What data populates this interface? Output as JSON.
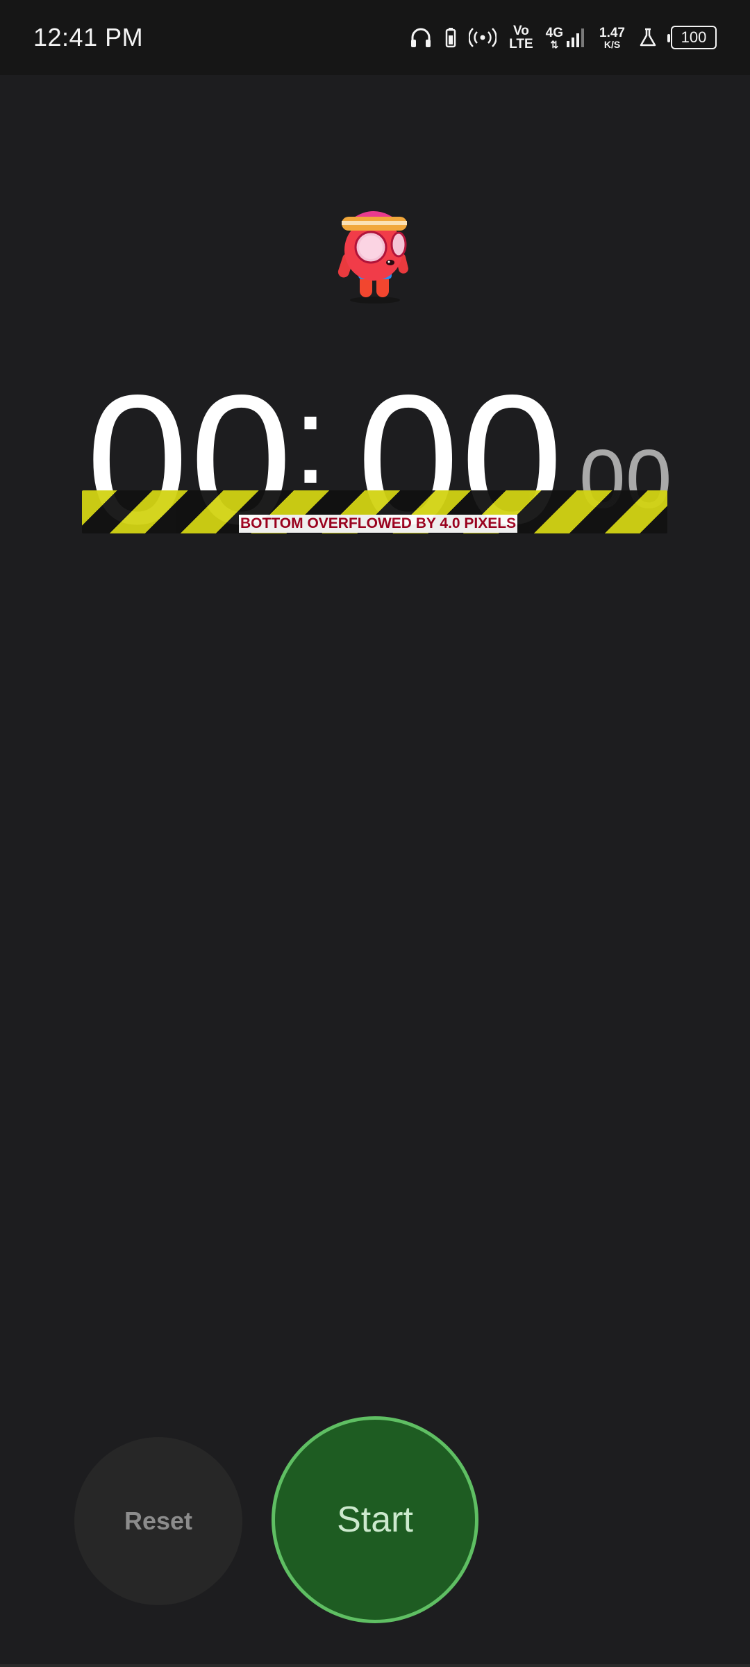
{
  "status_bar": {
    "time": "12:41 PM",
    "volte_top": "Vo",
    "volte_bottom": "LTE",
    "network_type": "4G",
    "net_speed_value": "1.47",
    "net_speed_unit": "K/S",
    "battery_level": "100",
    "icons": [
      "headphones-icon",
      "battery-saver-icon",
      "hotspot-icon",
      "signal-icon",
      "lab-flask-icon"
    ]
  },
  "mascot": {
    "icon": "mascot-character-icon"
  },
  "timer": {
    "minutes": "00",
    "separator": ":",
    "seconds": "00",
    "centiseconds": "00"
  },
  "overflow_warning": {
    "text": "BOTTOM OVERFLOWED BY 4.0 PIXELS"
  },
  "controls": {
    "reset_label": "Reset",
    "start_label": "Start"
  },
  "colors": {
    "background": "#1d1d1f",
    "start_fill": "#1e5c22",
    "start_ring": "#5fbf63",
    "warning_yellow": "#d2d313",
    "warning_text": "#a0001e"
  }
}
